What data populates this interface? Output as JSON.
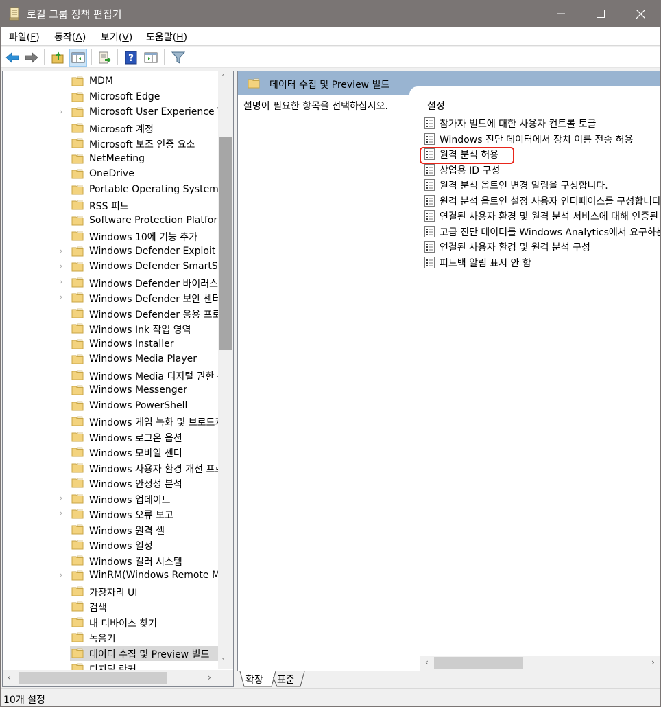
{
  "window": {
    "title": "로컬 그룹 정책 편집기",
    "icons": {
      "app": "policy-scroll-icon",
      "minimize": "minimize-icon",
      "maximize": "maximize-icon",
      "close": "close-icon"
    }
  },
  "menu": {
    "items": [
      {
        "label": "파일(",
        "key": "F",
        "end": ")"
      },
      {
        "label": "동작(",
        "key": "A",
        "end": ")"
      },
      {
        "label": "보기(",
        "key": "V",
        "end": ")"
      },
      {
        "label": "도움말(",
        "key": "H",
        "end": ")"
      }
    ]
  },
  "toolbar": {
    "buttons": [
      {
        "name": "back-button",
        "icon": "back-arrow-icon"
      },
      {
        "name": "forward-button",
        "icon": "forward-arrow-icon"
      },
      {
        "name": "up-one-level-button",
        "icon": "folder-up-icon"
      },
      {
        "name": "show-hide-tree-button",
        "icon": "console-tree-icon",
        "active": true
      },
      {
        "name": "export-list-button",
        "icon": "export-list-icon"
      },
      {
        "name": "help-button",
        "icon": "help-icon"
      },
      {
        "name": "show-hide-action-pane-button",
        "icon": "action-pane-icon"
      },
      {
        "name": "filter-button",
        "icon": "filter-icon"
      }
    ]
  },
  "tree": {
    "items": [
      {
        "label": "MDM",
        "expandable": false
      },
      {
        "label": "Microsoft Edge",
        "expandable": false
      },
      {
        "label": "Microsoft User Experience Virtualization",
        "expandable": true
      },
      {
        "label": "Microsoft 계정",
        "expandable": false
      },
      {
        "label": "Microsoft 보조 인증 요소",
        "expandable": false
      },
      {
        "label": "NetMeeting",
        "expandable": false
      },
      {
        "label": "OneDrive",
        "expandable": false
      },
      {
        "label": "Portable Operating System",
        "expandable": false
      },
      {
        "label": "RSS 피드",
        "expandable": false
      },
      {
        "label": "Software Protection Platform",
        "expandable": false
      },
      {
        "label": "Windows 10에 기능 추가",
        "expandable": false
      },
      {
        "label": "Windows Defender Exploit Guard",
        "expandable": true
      },
      {
        "label": "Windows Defender SmartScreen",
        "expandable": true
      },
      {
        "label": "Windows Defender 바이러스 백신",
        "expandable": true
      },
      {
        "label": "Windows Defender 보안 센터",
        "expandable": true
      },
      {
        "label": "Windows Defender 응용 프로그램 가드",
        "expandable": false
      },
      {
        "label": "Windows Ink 작업 영역",
        "expandable": false
      },
      {
        "label": "Windows Installer",
        "expandable": false
      },
      {
        "label": "Windows Media Player",
        "expandable": false
      },
      {
        "label": "Windows Media 디지털 권한 관리",
        "expandable": false
      },
      {
        "label": "Windows Messenger",
        "expandable": false
      },
      {
        "label": "Windows PowerShell",
        "expandable": false
      },
      {
        "label": "Windows 게임 녹화 및 브로드캐스트",
        "expandable": false
      },
      {
        "label": "Windows 로그온 옵션",
        "expandable": false
      },
      {
        "label": "Windows 모바일 센터",
        "expandable": false
      },
      {
        "label": "Windows 사용자 환경 개선 프로그램",
        "expandable": false
      },
      {
        "label": "Windows 안정성 분석",
        "expandable": false
      },
      {
        "label": "Windows 업데이트",
        "expandable": true
      },
      {
        "label": "Windows 오류 보고",
        "expandable": true
      },
      {
        "label": "Windows 원격 셸",
        "expandable": false
      },
      {
        "label": "Windows 일정",
        "expandable": false
      },
      {
        "label": "Windows 컬러 시스템",
        "expandable": false
      },
      {
        "label": "WinRM(Windows Remote Management)",
        "expandable": true
      },
      {
        "label": "가장자리 UI",
        "expandable": false
      },
      {
        "label": "검색",
        "expandable": false
      },
      {
        "label": "내 디바이스 찾기",
        "expandable": false
      },
      {
        "label": "녹음기",
        "expandable": false
      },
      {
        "label": "데이터 수집 및 Preview 빌드",
        "expandable": false,
        "selected": true
      },
      {
        "label": "디지털 락커",
        "expandable": false
      }
    ]
  },
  "details": {
    "header_title": "데이터 수집 및 Preview 빌드",
    "description": "설명이 필요한 항목을 선택하십시오.",
    "column_header": "설정",
    "settings": [
      {
        "label": "참가자 빌드에 대한 사용자 컨트롤 토글"
      },
      {
        "label": "Windows 진단 데이터에서 장치 이름 전송 허용"
      },
      {
        "label": "원격 분석 허용",
        "highlighted": true
      },
      {
        "label": "상업용 ID 구성"
      },
      {
        "label": "원격 분석 옵트인 변경 알림을 구성합니다."
      },
      {
        "label": "원격 분석 옵트인 설정 사용자 인터페이스를 구성합니다."
      },
      {
        "label": "연결된 사용자 환경 및 원격 분석 서비스에 대해 인증된 프록시 사용 구성"
      },
      {
        "label": "고급 진단 데이터를 Windows Analytics에서 요구하는 최소 데이터로 제한"
      },
      {
        "label": "연결된 사용자 환경 및 원격 분석 구성"
      },
      {
        "label": "피드백 알림 표시 안 함"
      }
    ],
    "highlight_color": "#e8261b"
  },
  "tabs": [
    {
      "label": "확장",
      "active": true
    },
    {
      "label": "표준",
      "active": false
    }
  ],
  "statusbar": {
    "text": "10개 설정"
  },
  "colors": {
    "titlebar": "#7a7574",
    "header_band": "#99b4d1",
    "selection": "#d9d9d9",
    "folder": "#f3d37e"
  }
}
